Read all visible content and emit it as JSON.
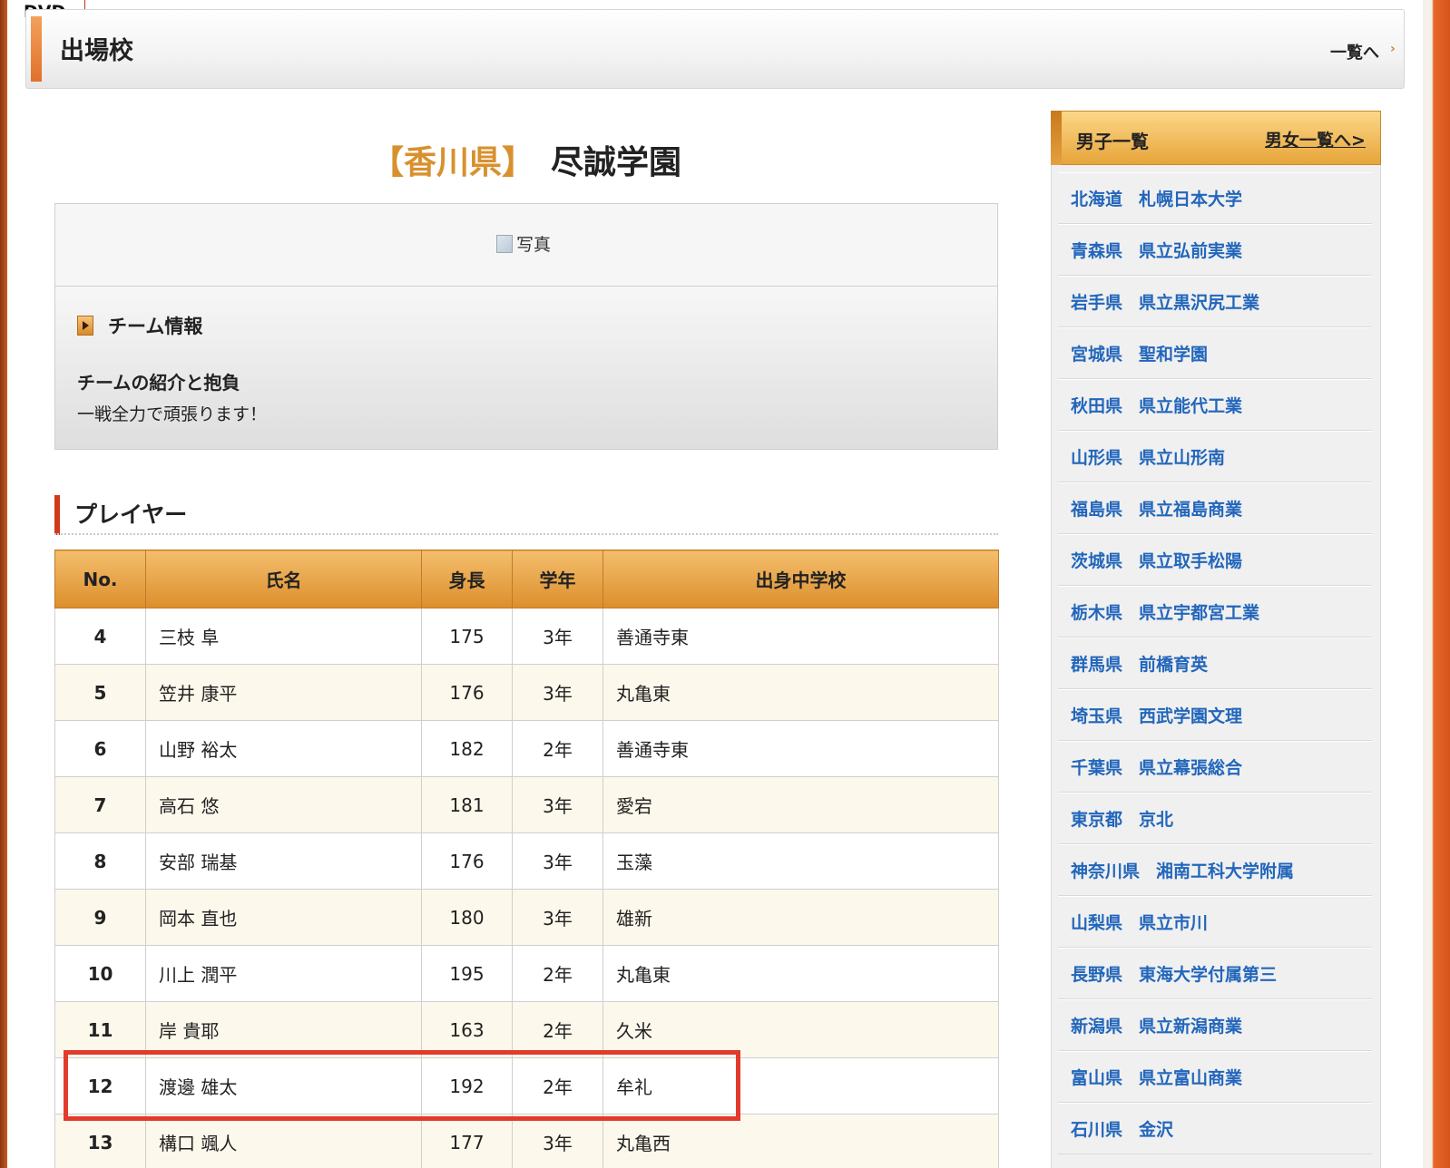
{
  "topbar": {
    "dvd_label": "DVD"
  },
  "header": {
    "title": "出場校",
    "list_link": "一覧へ",
    "arrow_glyph": "›"
  },
  "school": {
    "prefecture": "【香川県】",
    "name": "尽誠学園"
  },
  "photo": {
    "alt": "写真"
  },
  "team": {
    "heading": "チーム情報",
    "intro_label": "チームの紹介と抱負",
    "intro_text": "一戦全力で頑張ります！"
  },
  "players": {
    "title": "プレイヤー",
    "headers": [
      "No.",
      "氏名",
      "身長",
      "学年",
      "出身中学校"
    ],
    "rows": [
      {
        "no": "4",
        "name": "三枝 阜",
        "height": "175",
        "grade": "3年",
        "school": "善通寺東"
      },
      {
        "no": "5",
        "name": "笠井 康平",
        "height": "176",
        "grade": "3年",
        "school": "丸亀東"
      },
      {
        "no": "6",
        "name": "山野 裕太",
        "height": "182",
        "grade": "2年",
        "school": "善通寺東"
      },
      {
        "no": "7",
        "name": "高石 悠",
        "height": "181",
        "grade": "3年",
        "school": "愛宕"
      },
      {
        "no": "8",
        "name": "安部 瑞基",
        "height": "176",
        "grade": "3年",
        "school": "玉藻"
      },
      {
        "no": "9",
        "name": "岡本 直也",
        "height": "180",
        "grade": "3年",
        "school": "雄新"
      },
      {
        "no": "10",
        "name": "川上 潤平",
        "height": "195",
        "grade": "2年",
        "school": "丸亀東"
      },
      {
        "no": "11",
        "name": "岸 貴耶",
        "height": "163",
        "grade": "2年",
        "school": "久米"
      },
      {
        "no": "12",
        "name": "渡邊 雄太",
        "height": "192",
        "grade": "2年",
        "school": "牟礼"
      },
      {
        "no": "13",
        "name": "構口 颯人",
        "height": "177",
        "grade": "3年",
        "school": "丸亀西"
      }
    ]
  },
  "sidebar": {
    "title": "男子一覧",
    "all_link": "男女一覧へ>",
    "items": [
      {
        "pref": "北海道",
        "school": "札幌日本大学"
      },
      {
        "pref": "青森県",
        "school": "県立弘前実業"
      },
      {
        "pref": "岩手県",
        "school": "県立黒沢尻工業"
      },
      {
        "pref": "宮城県",
        "school": "聖和学園"
      },
      {
        "pref": "秋田県",
        "school": "県立能代工業"
      },
      {
        "pref": "山形県",
        "school": "県立山形南"
      },
      {
        "pref": "福島県",
        "school": "県立福島商業"
      },
      {
        "pref": "茨城県",
        "school": "県立取手松陽"
      },
      {
        "pref": "栃木県",
        "school": "県立宇都宮工業"
      },
      {
        "pref": "群馬県",
        "school": "前橋育英"
      },
      {
        "pref": "埼玉県",
        "school": "西武学園文理"
      },
      {
        "pref": "千葉県",
        "school": "県立幕張総合"
      },
      {
        "pref": "東京都",
        "school": "京北"
      },
      {
        "pref": "神奈川県",
        "school": "湘南工科大学附属"
      },
      {
        "pref": "山梨県",
        "school": "県立市川"
      },
      {
        "pref": "長野県",
        "school": "東海大学付属第三"
      },
      {
        "pref": "新潟県",
        "school": "県立新潟商業"
      },
      {
        "pref": "富山県",
        "school": "県立富山商業"
      },
      {
        "pref": "石川県",
        "school": "金沢"
      }
    ]
  },
  "colors": {
    "accent_orange": "#e0712c",
    "prefecture_gold": "#d8912e",
    "link_blue": "#2266bb",
    "highlight_red": "#e23b2c"
  }
}
